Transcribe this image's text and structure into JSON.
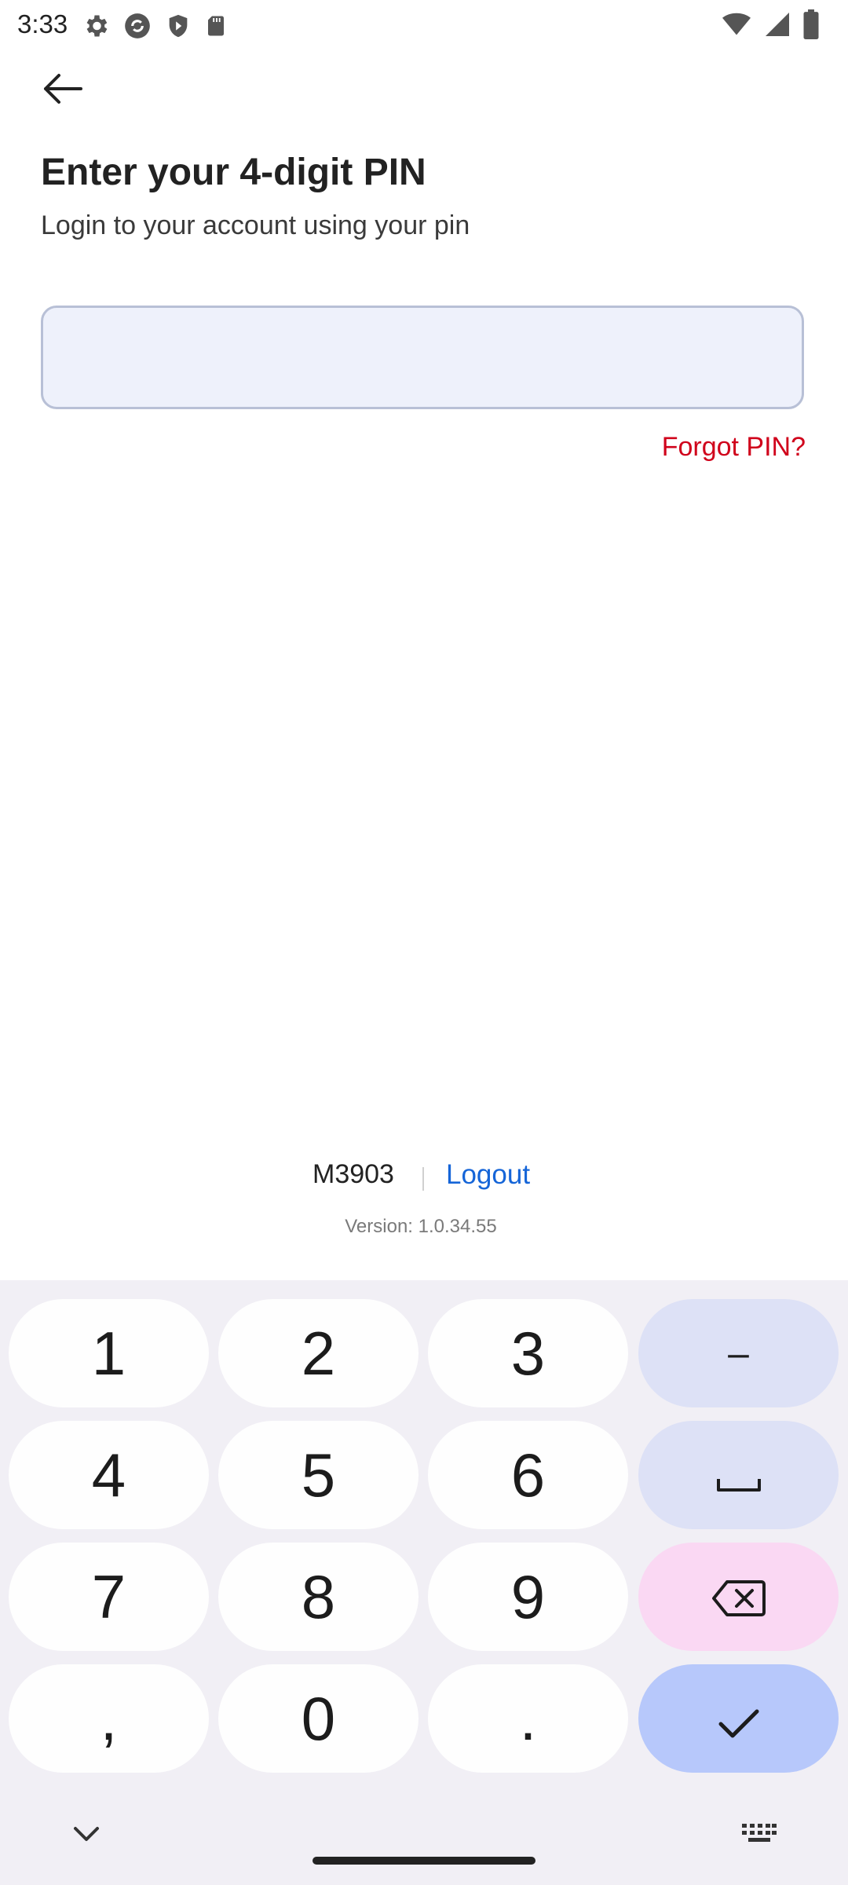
{
  "status_bar": {
    "time": "3:33",
    "left_icons": [
      "settings-gear-icon",
      "sync-icon",
      "shield-icon",
      "sd-card-icon"
    ],
    "right_icons": [
      "wifi-icon",
      "cell-signal-icon",
      "battery-icon"
    ]
  },
  "header": {
    "back_icon": "arrow-left-icon"
  },
  "main": {
    "title": "Enter your 4-digit PIN",
    "subtitle": "Login to your account using your pin",
    "pin_value": "",
    "forgot_label": "Forgot PIN?"
  },
  "footer": {
    "account_id": "M3903",
    "logout_label": "Logout",
    "version": "Version: 1.0.34.55"
  },
  "keyboard": {
    "rows": [
      [
        "1",
        "2",
        "3",
        "–"
      ],
      [
        "4",
        "5",
        "6",
        "space-icon"
      ],
      [
        "7",
        "8",
        "9",
        "backspace-icon"
      ],
      [
        ",",
        "0",
        ".",
        "check-icon"
      ]
    ],
    "collapse_icon": "chevron-down-icon",
    "switch_icon": "keyboard-icon"
  },
  "colors": {
    "accent_link": "#1565d8",
    "forgot_red": "#d0021b",
    "field_bg": "#eef1fb",
    "key_func": "#dde1f6",
    "key_delete": "#fad8f3",
    "key_enter": "#b7c8fb"
  }
}
